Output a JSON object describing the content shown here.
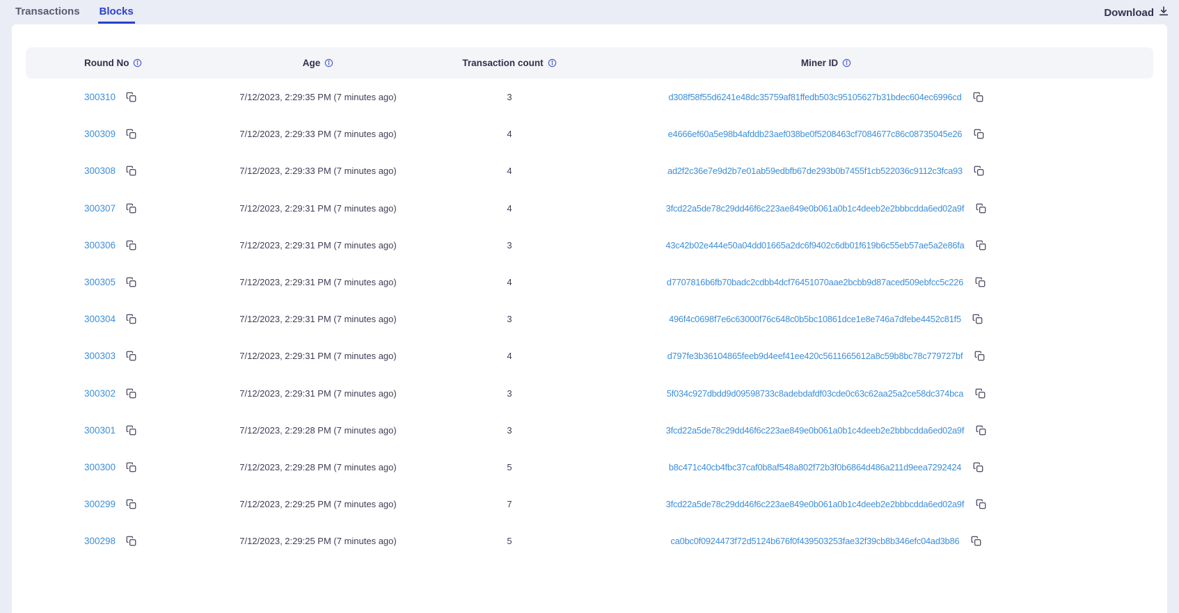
{
  "tabs": {
    "transactions": "Transactions",
    "blocks": "Blocks"
  },
  "toolbar": {
    "download_label": "Download"
  },
  "icons": {
    "download": "download-icon",
    "info": "info-icon",
    "copy": "copy-icon"
  },
  "colors": {
    "page_bg": "#eaecf6",
    "card_bg": "#ffffff",
    "header_bg": "#f4f5f9",
    "accent_blue": "#2a41cc",
    "link_blue": "#3d8ed8",
    "info_icon_blue": "#4a5fd0",
    "text_dark": "#33334d"
  },
  "table": {
    "columns": [
      {
        "label": "Round No"
      },
      {
        "label": "Age"
      },
      {
        "label": "Transaction count"
      },
      {
        "label": "Miner ID"
      }
    ],
    "rows": [
      {
        "round_no": "300310",
        "age": "7/12/2023, 2:29:35 PM (7 minutes ago)",
        "transaction_count": "3",
        "miner_id": "d308f58f55d6241e48dc35759af81ffedb503c95105627b31bdec604ec6996cd"
      },
      {
        "round_no": "300309",
        "age": "7/12/2023, 2:29:33 PM (7 minutes ago)",
        "transaction_count": "4",
        "miner_id": "e4666ef60a5e98b4afddb23aef038be0f5208463cf7084677c86c08735045e26"
      },
      {
        "round_no": "300308",
        "age": "7/12/2023, 2:29:33 PM (7 minutes ago)",
        "transaction_count": "4",
        "miner_id": "ad2f2c36e7e9d2b7e01ab59edbfb67de293b0b7455f1cb522036c9112c3fca93"
      },
      {
        "round_no": "300307",
        "age": "7/12/2023, 2:29:31 PM (7 minutes ago)",
        "transaction_count": "4",
        "miner_id": "3fcd22a5de78c29dd46f6c223ae849e0b061a0b1c4deeb2e2bbbcdda6ed02a9f"
      },
      {
        "round_no": "300306",
        "age": "7/12/2023, 2:29:31 PM (7 minutes ago)",
        "transaction_count": "3",
        "miner_id": "43c42b02e444e50a04dd01665a2dc6f9402c6db01f619b6c55eb57ae5a2e86fa"
      },
      {
        "round_no": "300305",
        "age": "7/12/2023, 2:29:31 PM (7 minutes ago)",
        "transaction_count": "4",
        "miner_id": "d7707816b6fb70badc2cdbb4dcf76451070aae2bcbb9d87aced509ebfcc5c226"
      },
      {
        "round_no": "300304",
        "age": "7/12/2023, 2:29:31 PM (7 minutes ago)",
        "transaction_count": "3",
        "miner_id": "496f4c0698f7e6c63000f76c648c0b5bc10861dce1e8e746a7dfebe4452c81f5"
      },
      {
        "round_no": "300303",
        "age": "7/12/2023, 2:29:31 PM (7 minutes ago)",
        "transaction_count": "4",
        "miner_id": "d797fe3b36104865feeb9d4eef41ee420c5611665612a8c59b8bc78c779727bf"
      },
      {
        "round_no": "300302",
        "age": "7/12/2023, 2:29:31 PM (7 minutes ago)",
        "transaction_count": "3",
        "miner_id": "5f034c927dbdd9d09598733c8adebdafdf03cde0c63c62aa25a2ce58dc374bca"
      },
      {
        "round_no": "300301",
        "age": "7/12/2023, 2:29:28 PM (7 minutes ago)",
        "transaction_count": "3",
        "miner_id": "3fcd22a5de78c29dd46f6c223ae849e0b061a0b1c4deeb2e2bbbcdda6ed02a9f"
      },
      {
        "round_no": "300300",
        "age": "7/12/2023, 2:29:28 PM (7 minutes ago)",
        "transaction_count": "5",
        "miner_id": "b8c471c40cb4fbc37caf0b8af548a802f72b3f0b6864d486a211d9eea7292424"
      },
      {
        "round_no": "300299",
        "age": "7/12/2023, 2:29:25 PM (7 minutes ago)",
        "transaction_count": "7",
        "miner_id": "3fcd22a5de78c29dd46f6c223ae849e0b061a0b1c4deeb2e2bbbcdda6ed02a9f"
      },
      {
        "round_no": "300298",
        "age": "7/12/2023, 2:29:25 PM (7 minutes ago)",
        "transaction_count": "5",
        "miner_id": "ca0bc0f0924473f72d5124b676f0f439503253fae32f39cb8b346efc04ad3b86"
      }
    ]
  }
}
